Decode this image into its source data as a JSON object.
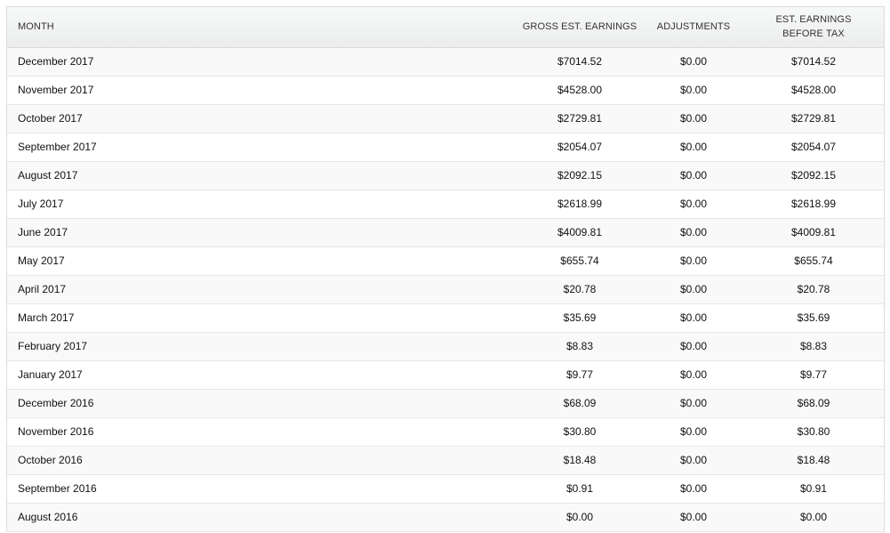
{
  "table": {
    "headers": {
      "month": "MONTH",
      "gross": "GROSS EST. EARNINGS",
      "adjustments": "ADJUSTMENTS",
      "est_line1": "EST. EARNINGS",
      "est_line2": "BEFORE TAX"
    },
    "rows": [
      {
        "month": "December 2017",
        "gross": "$7014.52",
        "adjustments": "$0.00",
        "est": "$7014.52"
      },
      {
        "month": "November 2017",
        "gross": "$4528.00",
        "adjustments": "$0.00",
        "est": "$4528.00"
      },
      {
        "month": "October 2017",
        "gross": "$2729.81",
        "adjustments": "$0.00",
        "est": "$2729.81"
      },
      {
        "month": "September 2017",
        "gross": "$2054.07",
        "adjustments": "$0.00",
        "est": "$2054.07"
      },
      {
        "month": "August 2017",
        "gross": "$2092.15",
        "adjustments": "$0.00",
        "est": "$2092.15"
      },
      {
        "month": "July 2017",
        "gross": "$2618.99",
        "adjustments": "$0.00",
        "est": "$2618.99"
      },
      {
        "month": "June 2017",
        "gross": "$4009.81",
        "adjustments": "$0.00",
        "est": "$4009.81"
      },
      {
        "month": "May 2017",
        "gross": "$655.74",
        "adjustments": "$0.00",
        "est": "$655.74"
      },
      {
        "month": "April 2017",
        "gross": "$20.78",
        "adjustments": "$0.00",
        "est": "$20.78"
      },
      {
        "month": "March 2017",
        "gross": "$35.69",
        "adjustments": "$0.00",
        "est": "$35.69"
      },
      {
        "month": "February 2017",
        "gross": "$8.83",
        "adjustments": "$0.00",
        "est": "$8.83"
      },
      {
        "month": "January 2017",
        "gross": "$9.77",
        "adjustments": "$0.00",
        "est": "$9.77"
      },
      {
        "month": "December 2016",
        "gross": "$68.09",
        "adjustments": "$0.00",
        "est": "$68.09"
      },
      {
        "month": "November 2016",
        "gross": "$30.80",
        "adjustments": "$0.00",
        "est": "$30.80"
      },
      {
        "month": "October 2016",
        "gross": "$18.48",
        "adjustments": "$0.00",
        "est": "$18.48"
      },
      {
        "month": "September 2016",
        "gross": "$0.91",
        "adjustments": "$0.00",
        "est": "$0.91"
      },
      {
        "month": "August 2016",
        "gross": "$0.00",
        "adjustments": "$0.00",
        "est": "$0.00"
      }
    ]
  }
}
